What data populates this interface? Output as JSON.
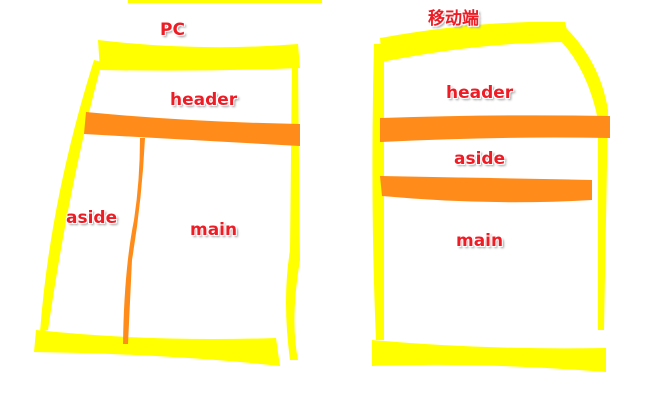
{
  "pc": {
    "title": "PC",
    "header": "header",
    "aside": "aside",
    "main": "main"
  },
  "mobile": {
    "title": "移动端",
    "header": "header",
    "aside": "aside",
    "main": "main"
  },
  "colors": {
    "frame": "#ffff00",
    "divider": "#ff8c1a",
    "label": "#ee1c25"
  }
}
